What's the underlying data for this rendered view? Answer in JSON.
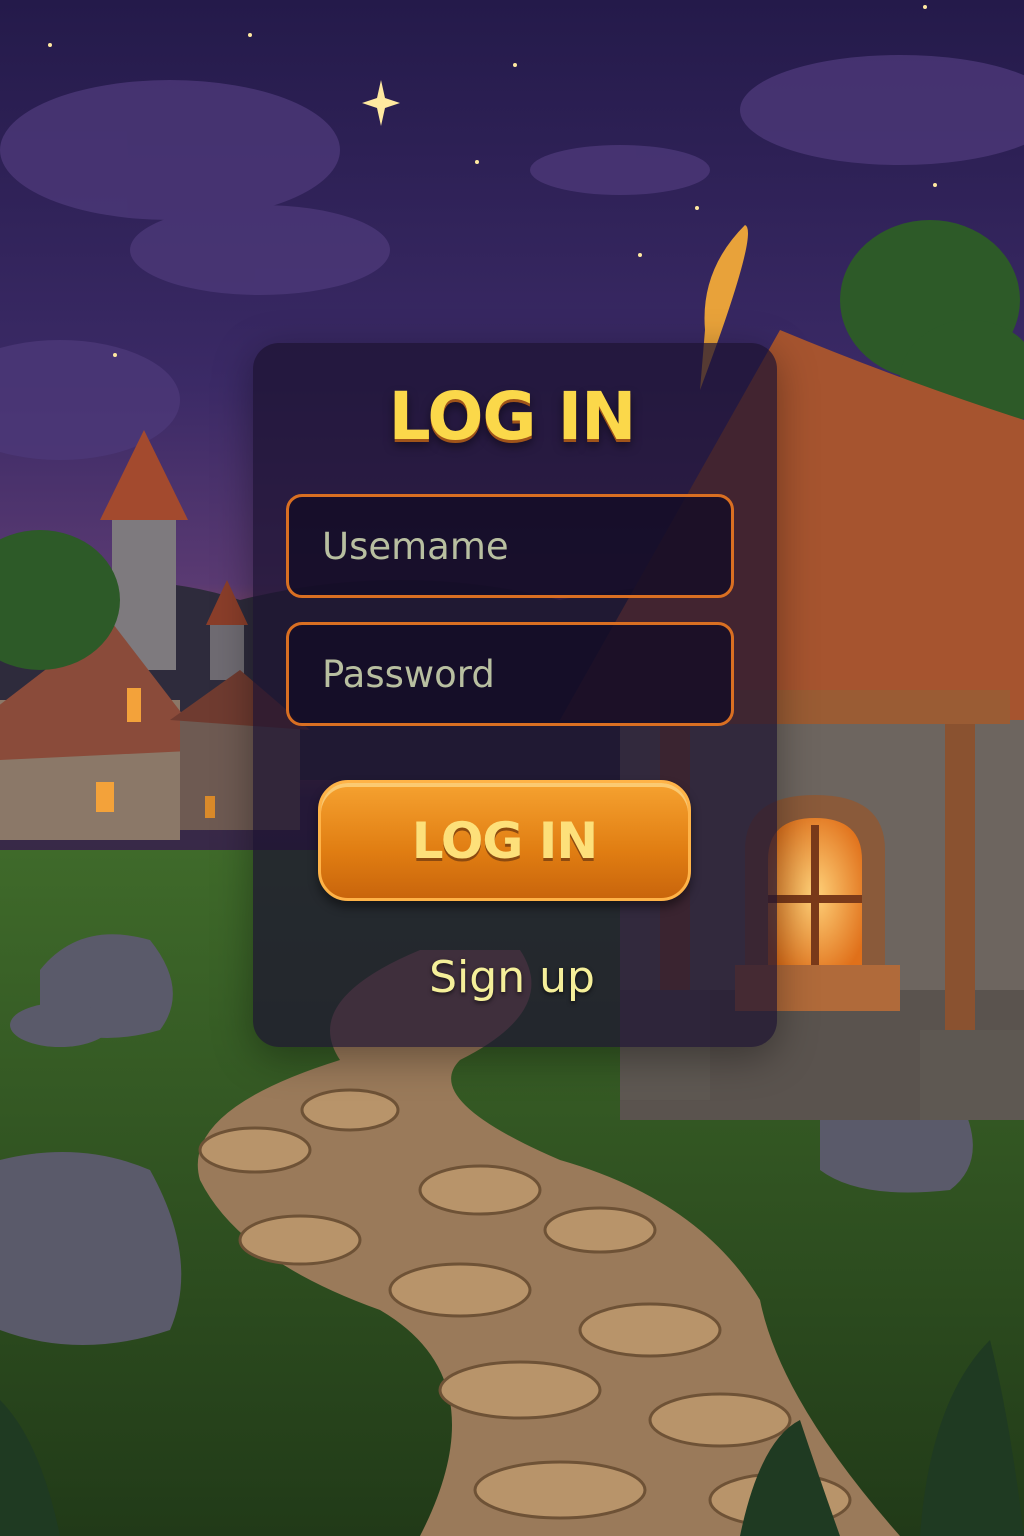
{
  "colors": {
    "title": "#fbd84a",
    "button_text": "#fde07a",
    "link": "#f5ef9a",
    "input_text": "#b8bfa0",
    "field_border": "#d96f22",
    "accent_orange": "#e98c1e"
  },
  "login": {
    "title": "LOG IN",
    "username_placeholder": "Usemame",
    "password_placeholder": "Password",
    "submit_label": "LOG IN",
    "signup_label": "Sign up"
  }
}
